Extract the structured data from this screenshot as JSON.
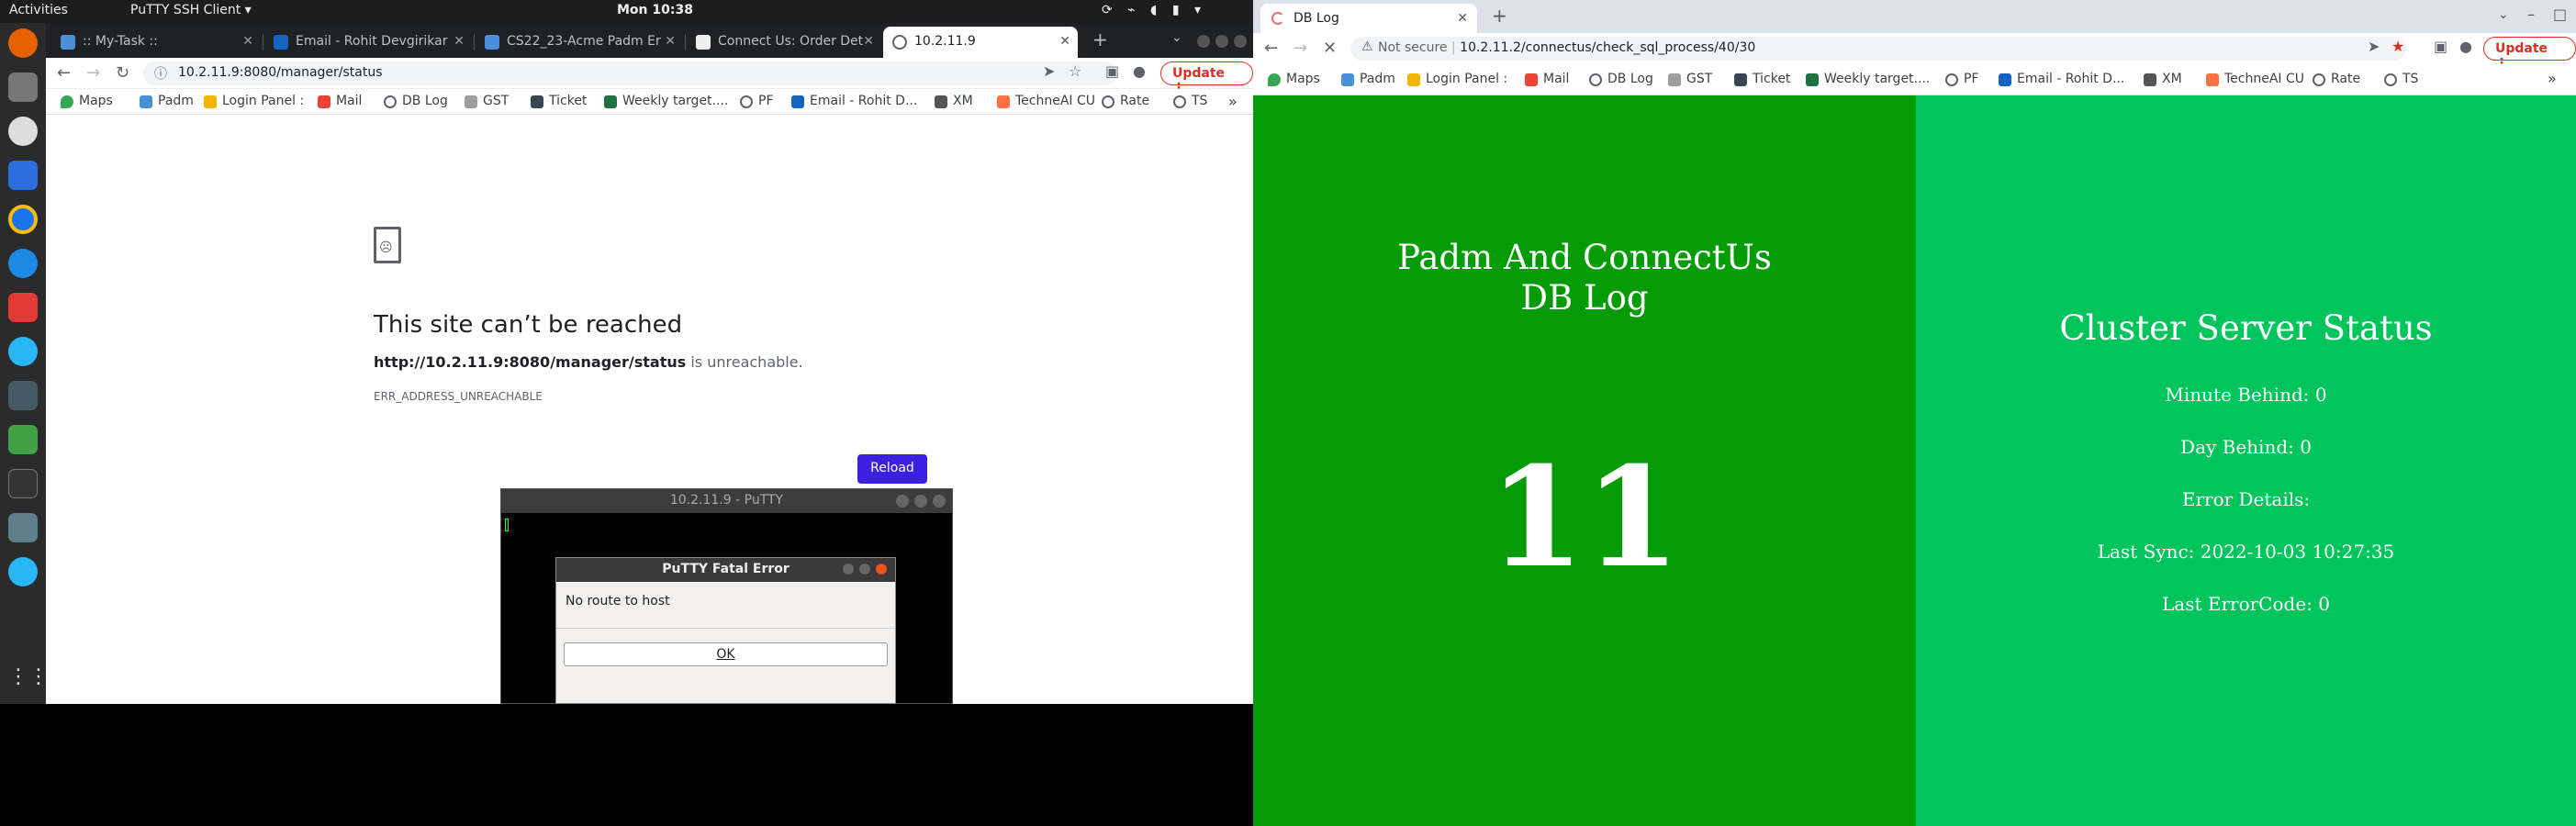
{
  "topbar": {
    "activities": "Activities",
    "app_menu": "PuTTY SSH Client ▾",
    "clock": "Mon 10:38"
  },
  "left_browser": {
    "tabs": [
      {
        "label": ":: My-Task ::"
      },
      {
        "label": "Email - Rohit Devgirikar"
      },
      {
        "label": "CS22_23-Acme Padm Er"
      },
      {
        "label": "Connect Us: Order Det"
      },
      {
        "label": "10.2.11.9",
        "active": true
      }
    ],
    "url": "10.2.11.9:8080/manager/status",
    "update_label": "Update",
    "bookmarks": [
      "Maps",
      "Padm",
      "Login Panel :",
      "Mail",
      "DB Log",
      "GST",
      "Ticket",
      "Weekly target....",
      "PF",
      "Email - Rohit D...",
      "XM",
      "TechneAI CU",
      "Rate",
      "TS"
    ],
    "error": {
      "title": "This site can’t be reached",
      "url_bold": "http://10.2.11.9:8080/manager/status",
      "url_rest": " is unreachable.",
      "code": "ERR_ADDRESS_UNREACHABLE",
      "reload_label": "Reload"
    }
  },
  "putty": {
    "title": "10.2.11.9 - PuTTY",
    "dialog_title": "PuTTY Fatal Error",
    "message": "No route to host",
    "ok_label": "OK"
  },
  "right_browser": {
    "tab_label": "DB Log",
    "not_secure": "Not secure",
    "url": "10.2.11.2/connectus/check_sql_process/40/30",
    "update_label": "Update",
    "bookmarks": [
      "Maps",
      "Padm",
      "Login Panel :",
      "Mail",
      "DB Log",
      "GST",
      "Ticket",
      "Weekly target....",
      "PF",
      "Email - Rohit D...",
      "XM",
      "TechneAI CU",
      "Rate",
      "TS"
    ],
    "db_title_line1": "Padm And ConnectUs",
    "db_title_line2": "DB Log",
    "db_count": "11",
    "cluster_title": "Cluster Server Status",
    "minute_behind": "Minute Behind: 0",
    "day_behind": "Day Behind: 0",
    "error_details": "Error Details:",
    "last_sync": "Last Sync: 2022-10-03 10:27:35",
    "last_error_code": "Last ErrorCode: 0"
  },
  "colors": {
    "panel_left": "#039b06",
    "panel_right": "#00c45c",
    "reload_button": "#3c1fe0"
  }
}
